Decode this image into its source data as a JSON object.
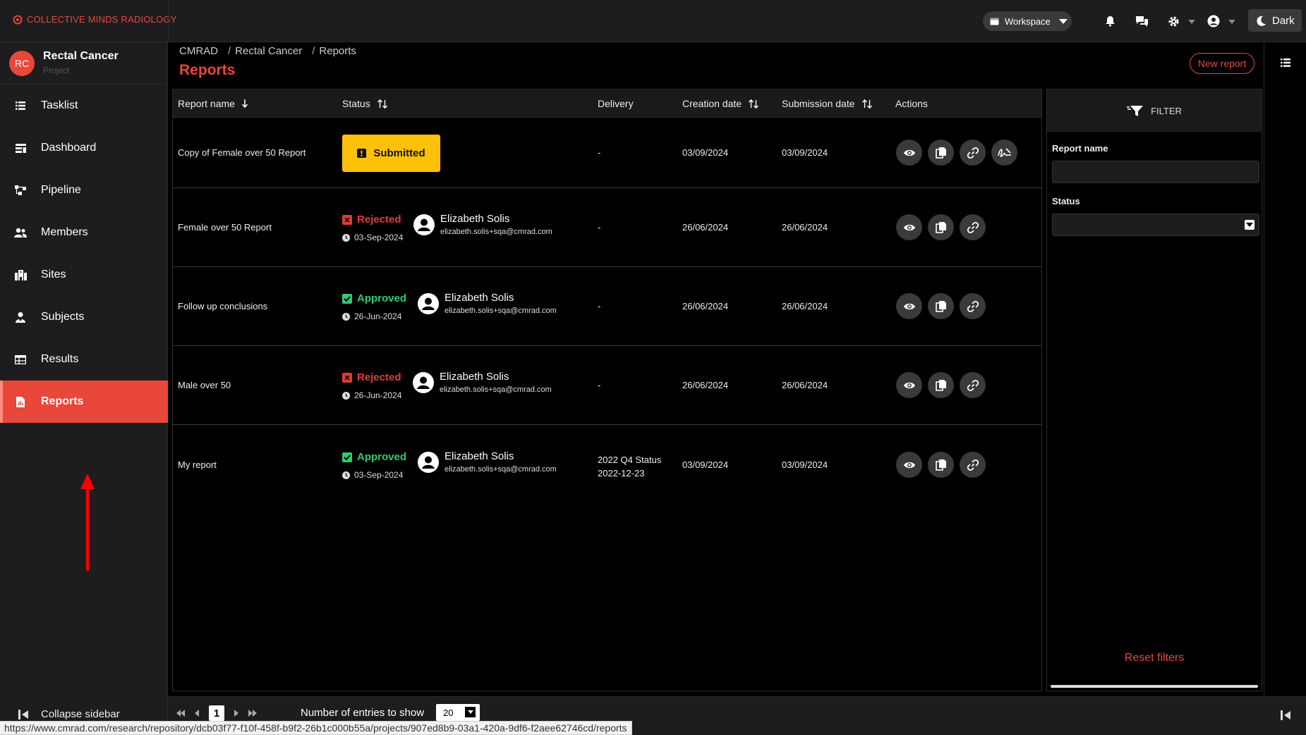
{
  "brand": {
    "name": "COLLECTIVE MINDS RADIOLOGY"
  },
  "topbar": {
    "workspace_label": "Workspace",
    "theme_label": "Dark"
  },
  "project": {
    "initials": "RC",
    "name": "Rectal Cancer",
    "subtitle": "Project"
  },
  "sidebar": {
    "items": [
      {
        "label": "Tasklist",
        "icon": "tasklist-icon"
      },
      {
        "label": "Dashboard",
        "icon": "dashboard-icon"
      },
      {
        "label": "Pipeline",
        "icon": "pipeline-icon"
      },
      {
        "label": "Members",
        "icon": "members-icon"
      },
      {
        "label": "Sites",
        "icon": "sites-icon"
      },
      {
        "label": "Subjects",
        "icon": "subjects-icon"
      },
      {
        "label": "Results",
        "icon": "results-icon"
      },
      {
        "label": "Reports",
        "icon": "reports-icon",
        "active": true
      }
    ],
    "collapse_label": "Collapse sidebar"
  },
  "breadcrumb": [
    "CMRAD",
    "Rectal Cancer",
    "Reports"
  ],
  "page": {
    "title": "Reports",
    "new_report_label": "New report"
  },
  "table": {
    "headers": [
      "Report name",
      "Status",
      "Delivery",
      "Creation date",
      "Submission date",
      "Actions"
    ],
    "rows": [
      {
        "name": "Copy of Female over 50 Report",
        "status": "Submitted",
        "status_date": "",
        "user_name": "",
        "user_email": "",
        "delivery": "-",
        "delivery_2": "",
        "created": "03/09/2024",
        "submitted": "03/09/2024"
      },
      {
        "name": "Female over 50 Report",
        "status": "Rejected",
        "status_date": "03-Sep-2024",
        "user_name": "Elizabeth Solis",
        "user_email": "elizabeth.solis+sqa@cmrad.com",
        "delivery": "-",
        "delivery_2": "",
        "created": "26/06/2024",
        "submitted": "26/06/2024"
      },
      {
        "name": "Follow up conclusions",
        "status": "Approved",
        "status_date": "26-Jun-2024",
        "user_name": "Elizabeth Solis",
        "user_email": "elizabeth.solis+sqa@cmrad.com",
        "delivery": "-",
        "delivery_2": "",
        "created": "26/06/2024",
        "submitted": "26/06/2024"
      },
      {
        "name": "Male over 50",
        "status": "Rejected",
        "status_date": "26-Jun-2024",
        "user_name": "Elizabeth Solis",
        "user_email": "elizabeth.solis+sqa@cmrad.com",
        "delivery": "-",
        "delivery_2": "",
        "created": "26/06/2024",
        "submitted": "26/06/2024"
      },
      {
        "name": "My report",
        "status": "Approved",
        "status_date": "03-Sep-2024",
        "user_name": "Elizabeth Solis",
        "user_email": "elizabeth.solis+sqa@cmrad.com",
        "delivery": "2022 Q4 Status",
        "delivery_2": "2022-12-23",
        "created": "03/09/2024",
        "submitted": "03/09/2024"
      }
    ]
  },
  "filter": {
    "title": "FILTER",
    "report_name_label": "Report name",
    "report_name_value": "",
    "status_label": "Status",
    "status_value": "",
    "reset_label": "Reset filters"
  },
  "pagination": {
    "current_page": "1",
    "entries_label": "Number of entries to show",
    "entries_value": "20"
  },
  "status_url": "https://www.cmrad.com/research/repository/dcb03f77-f10f-458f-b9f2-26b1c000b55a/projects/907ed8b9-03a1-420a-9df6-f2aee62746cd/reports",
  "colors": {
    "accent": "#e8473a",
    "submitted": "#ffc107",
    "rejected": "#e53935",
    "approved": "#2ecc71",
    "annotation_arrow": "#ff0000"
  }
}
